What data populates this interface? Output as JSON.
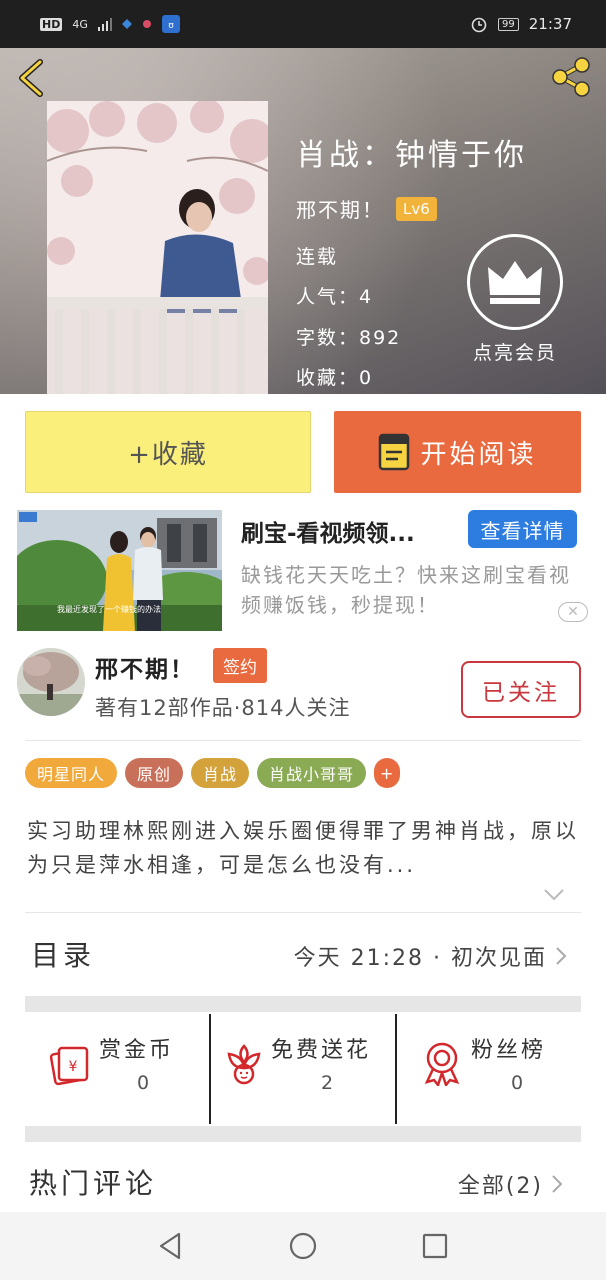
{
  "status_bar": {
    "hd": "HD",
    "network": "4G",
    "battery": "99",
    "time": "21:37"
  },
  "book": {
    "title": "肖战：钟情于你",
    "author": "邢不期！",
    "level": "Lv6",
    "status": "连载",
    "popularity": "人气：4",
    "word_count": "字数：892",
    "favorites": "收藏：0",
    "vip_label": "点亮会员"
  },
  "actions": {
    "collect_label": "+收藏",
    "read_label": "开始阅读"
  },
  "ad": {
    "thumb_caption": "我最近发现了一个赚钱的办法",
    "title": "刷宝-看视频领...",
    "button": "查看详情",
    "description": "缺钱花天天吃土？快来这刷宝看视频赚饭钱，秒提现！",
    "close": "✕"
  },
  "author_card": {
    "name": "邢不期！",
    "badge": "签约",
    "stats": "著有12部作品·814人关注",
    "follow_label": "已关注"
  },
  "tags": [
    {
      "label": "明星同人",
      "color": "#f2a93b"
    },
    {
      "label": "原创",
      "color": "#c9705a"
    },
    {
      "label": "肖战",
      "color": "#d4a23b"
    },
    {
      "label": "肖战小哥哥",
      "color": "#8aab54"
    },
    {
      "label": "+",
      "color": "#ea6a3f"
    }
  ],
  "synopsis": "实习助理林熙刚进入娱乐圈便得罪了男神肖战，原以为只是萍水相逢，可是怎么也没有...",
  "toc": {
    "title": "目录",
    "latest": "今天 21:28 · 初次见面"
  },
  "rewards": [
    {
      "label": "赏金币",
      "count": "0",
      "icon": "red-envelope-icon"
    },
    {
      "label": "免费送花",
      "count": "2",
      "icon": "flower-icon"
    },
    {
      "label": "粉丝榜",
      "count": "0",
      "icon": "medal-icon"
    }
  ],
  "comments": {
    "title": "热门评论",
    "all_label": "全部(2)"
  },
  "colors": {
    "accent_orange": "#ea6a3f",
    "collect_yellow": "#faef7a",
    "follow_red": "#c8383e",
    "ad_blue": "#2d7de1",
    "level_gold": "#f2b33a"
  }
}
